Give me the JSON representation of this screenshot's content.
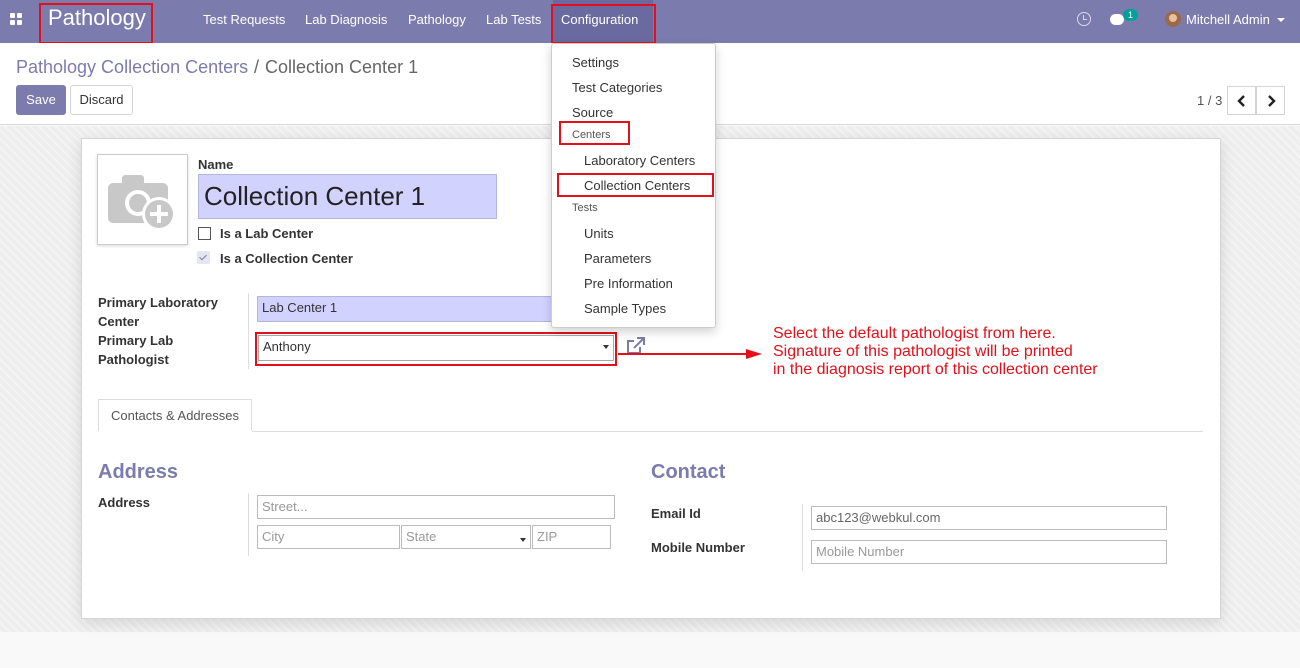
{
  "navbar": {
    "brand": "Pathology",
    "menu": [
      "Test Requests",
      "Lab Diagnosis",
      "Pathology",
      "Lab Tests",
      "Configuration"
    ],
    "active_menu": "Configuration",
    "chat_count": "1",
    "user": "Mitchell Admin"
  },
  "breadcrumb": {
    "parent": "Pathology Collection Centers",
    "separator": "/",
    "current": "Collection Center 1"
  },
  "buttons": {
    "save": "Save",
    "discard": "Discard"
  },
  "pager": {
    "text": "1 / 3"
  },
  "form": {
    "name_label": "Name",
    "name_value": "Collection Center 1",
    "is_lab_center_label": "Is a Lab Center",
    "is_lab_center": false,
    "is_collection_center_label": "Is a Collection Center",
    "is_collection_center": true,
    "primary_lab_label_1": "Primary Laboratory",
    "primary_lab_label_2": "Center",
    "primary_lab_value": "Lab Center 1",
    "pathologist_label_1": "Primary Lab",
    "pathologist_label_2": "Pathologist",
    "pathologist_value": "Anthony"
  },
  "tabs": [
    {
      "label": "Contacts & Addresses"
    }
  ],
  "address": {
    "title": "Address",
    "label": "Address",
    "street_placeholder": "Street...",
    "city_placeholder": "City",
    "state_placeholder": "State",
    "zip_placeholder": "ZIP"
  },
  "contact": {
    "title": "Contact",
    "email_label": "Email Id",
    "email_value": "abc123@webkul.com",
    "mobile_label": "Mobile Number",
    "mobile_placeholder": "Mobile Number"
  },
  "dropdown": {
    "items": [
      "Settings",
      "Test Categories",
      "Source"
    ],
    "centers_header": "Centers",
    "centers_items": [
      "Laboratory Centers",
      "Collection Centers"
    ],
    "tests_header": "Tests",
    "tests_items": [
      "Units",
      "Parameters",
      "Pre Information",
      "Sample Types"
    ]
  },
  "annotation": {
    "lines": [
      "Select the default pathologist from here.",
      "Signature of this pathologist will be printed",
      "in the diagnosis report of this collection center"
    ]
  },
  "colors": {
    "navbar": "#7c7bad",
    "highlight": "#e3101a",
    "required_field": "#d2d2ff"
  }
}
